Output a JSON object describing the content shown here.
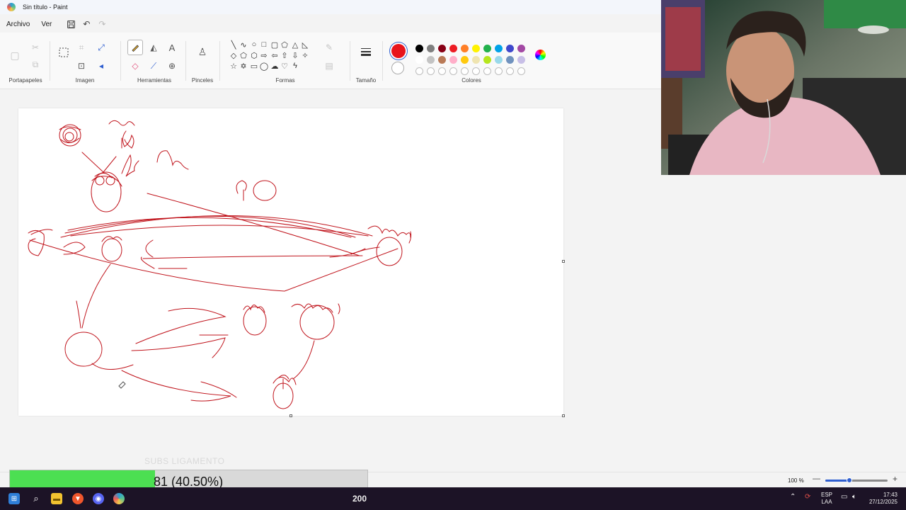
{
  "window": {
    "title": "Sin título - Paint"
  },
  "menu": {
    "file": "Archivo",
    "view": "Ver"
  },
  "ribbon": {
    "groups": {
      "clipboard": "Portapapeles",
      "image": "Imagen",
      "tools": "Herramientas",
      "brushes": "Pinceles",
      "shapes": "Formas",
      "size": "Tamaño",
      "colors": "Colores"
    },
    "text_tool_glyph": "A",
    "primary_color": "#e8141c",
    "secondary_color": "#ffffff",
    "palette_row1": [
      "#000000",
      "#7f7f7f",
      "#880015",
      "#ed1c24",
      "#ff7f27",
      "#fff200",
      "#22b14c",
      "#00a2e8",
      "#3f48cc",
      "#a349a4"
    ],
    "palette_row2": [
      "#ffffff",
      "#c3c3c3",
      "#b97a57",
      "#ffaec9",
      "#ffc90e",
      "#efe4b0",
      "#b5e61d",
      "#99d9ea",
      "#7092be",
      "#c8bfe7"
    ]
  },
  "status": {
    "zoom": "100 %"
  },
  "overlay": {
    "subs_watermark": "SUBS LIGAMENTO",
    "progress_label": "81 (40.50%)",
    "progress_fraction": 0.405
  },
  "taskbar": {
    "center_count": "200",
    "lang_line1": "ESP",
    "lang_line2": "LAA",
    "time": "17:43",
    "date": "27/12/2025"
  }
}
